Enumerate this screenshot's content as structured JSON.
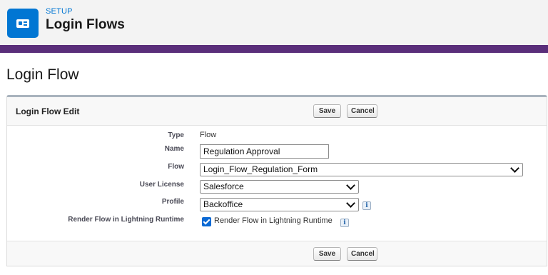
{
  "header": {
    "label": "SETUP",
    "title": "Login Flows",
    "icon": "contact-card-icon",
    "accent": "#0176d3",
    "band_color": "#5a2e7a"
  },
  "page": {
    "title": "Login Flow"
  },
  "panel": {
    "title": "Login Flow Edit",
    "save_label": "Save",
    "cancel_label": "Cancel"
  },
  "form": {
    "type": {
      "label": "Type",
      "value": "Flow"
    },
    "name": {
      "label": "Name",
      "value": "Regulation Approval"
    },
    "flow": {
      "label": "Flow",
      "value": "Login_Flow_Regulation_Form"
    },
    "user_license": {
      "label": "User License",
      "value": "Salesforce"
    },
    "profile": {
      "label": "Profile",
      "value": "Backoffice"
    },
    "render_flow": {
      "label": "Render Flow in Lightning Runtime",
      "checkbox_label": "Render Flow in Lightning Runtime",
      "checked": true
    }
  },
  "info_glyph": "i"
}
